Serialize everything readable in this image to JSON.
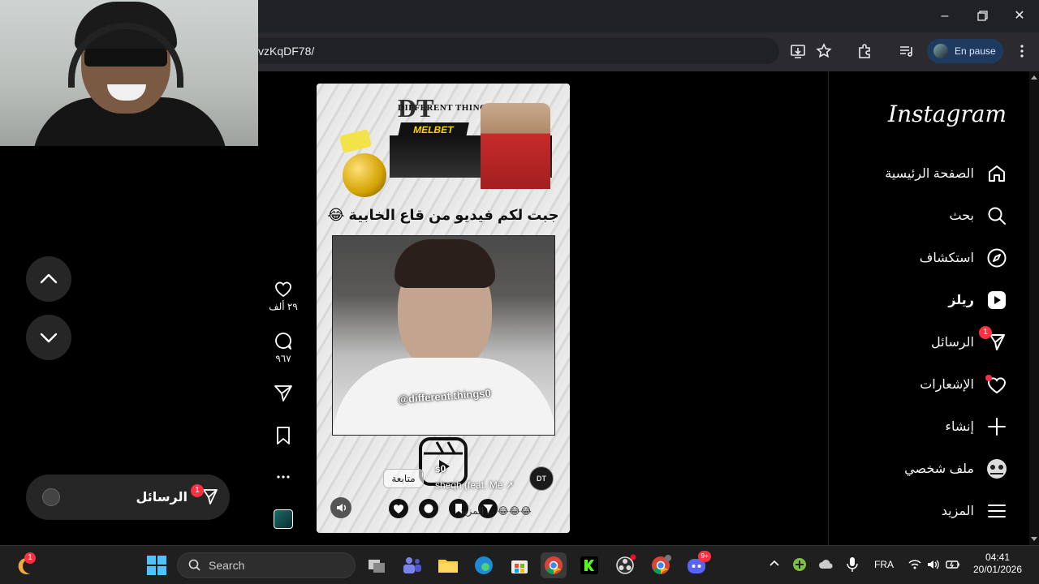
{
  "browser": {
    "url_fragment": "vzKqDF78/",
    "profile_label": "En pause"
  },
  "messages_pill": {
    "label": "الرسائل",
    "badge": "1"
  },
  "reel": {
    "banner_logo": "DT",
    "banner_brand": "DIFFERENT THINGS",
    "banner_sponsor": "MELBET",
    "caption": "جبت لكم فيديو من قاع الخابية 😂",
    "video_watermark": "@different.things0",
    "author_avatar": "DT",
    "follow_label": "متابعة",
    "username": "s0",
    "audio": "sheqh (feat. Me ↗",
    "description": "😂😂😂 ... المزيد"
  },
  "actions": {
    "likes": "٢٩ ألف",
    "comments": "٩٦٧"
  },
  "sidebar": {
    "logo": "Instagram",
    "items": [
      {
        "label": "الصفحة الرئيسية",
        "icon": "home-icon"
      },
      {
        "label": "بحث",
        "icon": "search-icon"
      },
      {
        "label": "استكشاف",
        "icon": "compass-icon"
      },
      {
        "label": "ريلز",
        "icon": "reels-icon"
      },
      {
        "label": "الرسائل",
        "icon": "send-icon",
        "badge": "1"
      },
      {
        "label": "الإشعارات",
        "icon": "heart-icon"
      },
      {
        "label": "إنشاء",
        "icon": "plus-icon"
      },
      {
        "label": "ملف شخصي",
        "icon": "profile-avatar"
      },
      {
        "label": "المزيد",
        "icon": "menu-icon"
      }
    ]
  },
  "taskbar": {
    "search_label": "Search",
    "language": "FRA",
    "time": "04:41",
    "date": "20/01/2026",
    "notification_badge": "1",
    "discord_badge": "9+"
  }
}
